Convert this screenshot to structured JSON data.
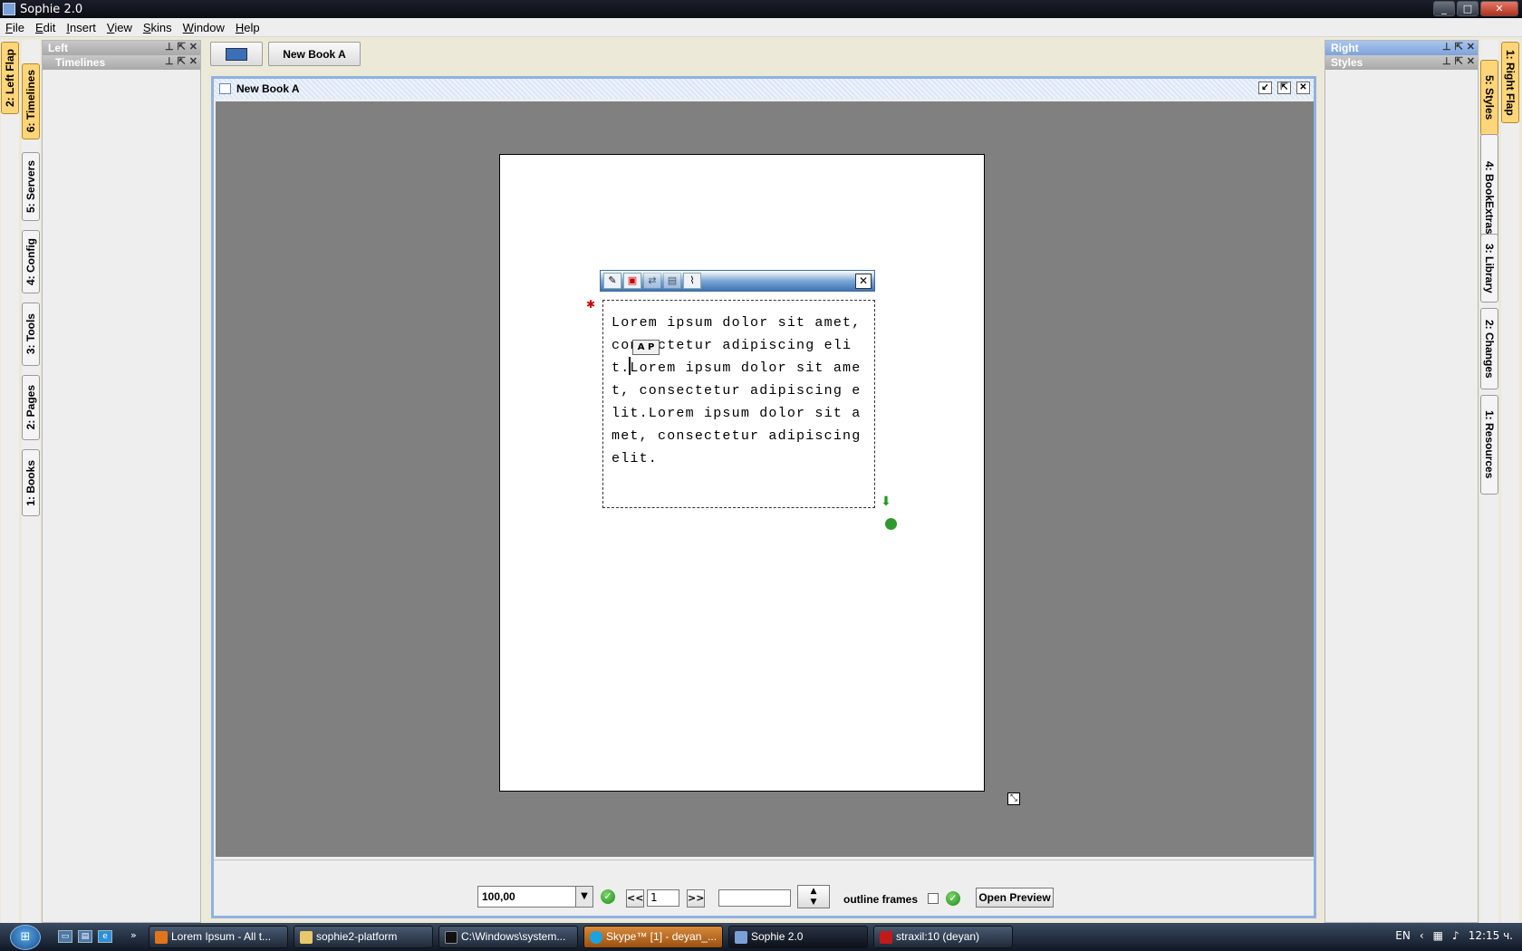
{
  "window": {
    "title": "Sophie 2.0",
    "controls": {
      "minimize": "_",
      "maximize": "□",
      "close": "✕"
    }
  },
  "menu": [
    "File",
    "Edit",
    "Insert",
    "View",
    "Skins",
    "Window",
    "Help"
  ],
  "left_flap_tabs": [
    "2: Left Flap"
  ],
  "left_tabs": [
    "6: Timelines",
    "5: Servers",
    "4: Config",
    "3: Tools",
    "2: Pages",
    "1: Books"
  ],
  "right_tabs": [
    "5: Styles",
    "4: BookExtras",
    "3: Library",
    "2: Changes",
    "1: Resources"
  ],
  "right_flap_tabs": [
    "1: Right Flap"
  ],
  "left_panel": {
    "header": "Left",
    "sub_header": "Timelines"
  },
  "right_panel": {
    "header": "Right",
    "sub_header": "Styles"
  },
  "panel_buttons": {
    "pin": "⊥",
    "float": "⇱",
    "close": "✕"
  },
  "toolbar": {
    "book_tab": "New Book A"
  },
  "document": {
    "title": "New Book A",
    "frame_text": "Lorem ipsum dolor sit amet, consectetur adipiscing elit.Lorem ipsum dolor sit amet, consectetur adipiscing elit.Lorem ipsum dolor sit amet, consectetur adipiscing elit.",
    "text_badge": "A P",
    "frame_close": "✕"
  },
  "bottom": {
    "zoom_value": "100,00",
    "prev_label": "<<",
    "page_number": "1",
    "next_label": ">>",
    "outline_label": "outline frames",
    "preview_label": "Open Preview"
  },
  "taskbar": {
    "start_label": "⊞",
    "items": [
      {
        "label": "Lorem Ipsum - All t...",
        "state": "normal"
      },
      {
        "label": "sophie2-platform",
        "state": "normal"
      },
      {
        "label": "C:\\Windows\\system...",
        "state": "normal"
      },
      {
        "label": "Skype™ [1] - deyan_...",
        "state": "alert"
      },
      {
        "label": "Sophie 2.0",
        "state": "active"
      },
      {
        "label": "straxil:10 (deyan)",
        "state": "normal"
      }
    ],
    "language": "EN",
    "clock": "12:15 ч."
  },
  "colors": {
    "accent": "#8fb1e3",
    "workspace": "#808080",
    "active_tab": "#ffd57a"
  }
}
